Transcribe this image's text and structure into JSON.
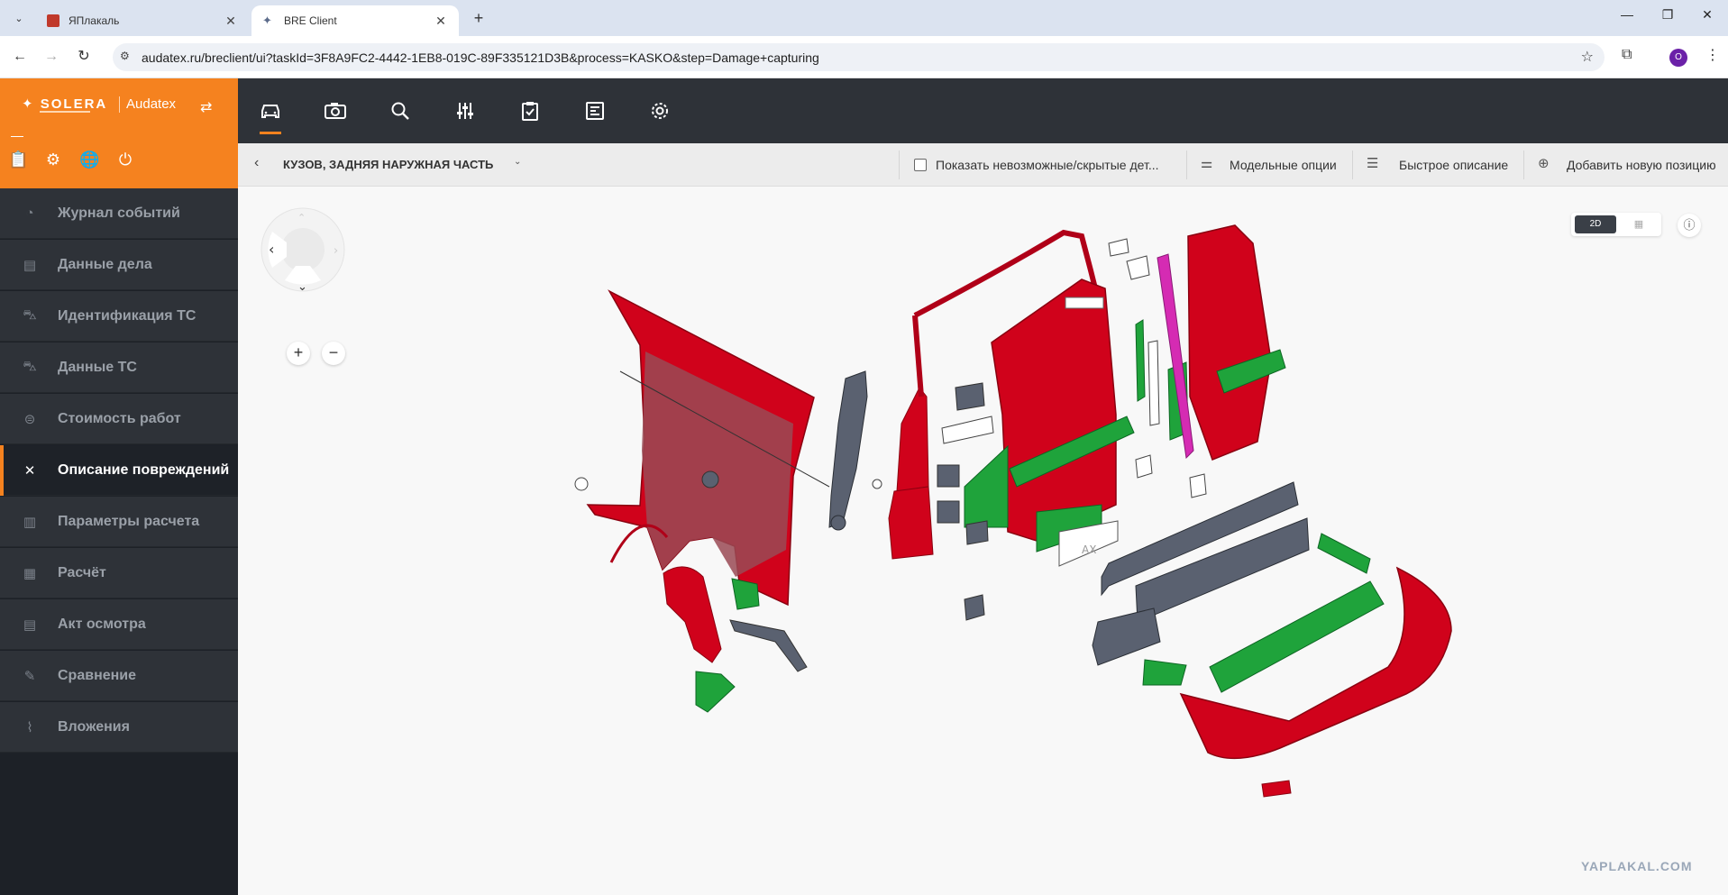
{
  "browser": {
    "tabs": [
      {
        "title": "ЯПлакаль",
        "active": false
      },
      {
        "title": "BRE Client",
        "active": true
      }
    ],
    "url": "audatex.ru/breclient/ui?taskId=3F8A9FC2-4442-1EB8-019C-89F335121D3B&process=KASKO&step=Damage+capturing",
    "profile_initial": "O"
  },
  "brand": {
    "logo": "SOLERA",
    "product": "Audatex"
  },
  "sidebar": {
    "items": [
      {
        "label": "Журнал событий",
        "icon": "history-icon",
        "active": false
      },
      {
        "label": "Данные дела",
        "icon": "document-icon",
        "active": false
      },
      {
        "label": "Идентификация ТС",
        "icon": "car-icon",
        "active": false
      },
      {
        "label": "Данные ТС",
        "icon": "car-data-icon",
        "active": false
      },
      {
        "label": "Стоимость работ",
        "icon": "labor-cost-icon",
        "active": false
      },
      {
        "label": "Описание повреждений",
        "icon": "tools-icon",
        "active": true
      },
      {
        "label": "Параметры расчета",
        "icon": "calc-params-icon",
        "active": false
      },
      {
        "label": "Расчёт",
        "icon": "calculation-icon",
        "active": false
      },
      {
        "label": "Акт осмотра",
        "icon": "inspection-icon",
        "active": false
      },
      {
        "label": "Сравнение",
        "icon": "compare-icon",
        "active": false
      },
      {
        "label": "Вложения",
        "icon": "paperclip-icon",
        "active": false
      }
    ]
  },
  "subheader": {
    "section_title": "КУЗОВ, ЗАДНЯЯ НАРУЖНАЯ ЧАСТЬ",
    "show_hidden_label": "Показать невозможные/скрытые дет...",
    "show_hidden_checked": false,
    "model_options_label": "Модельные опции",
    "quick_desc_label": "Быстрое описание",
    "add_position_label": "Добавить новую позицию"
  },
  "view": {
    "mode_2d": "2D",
    "active_mode": "2D"
  },
  "watermark": "YAPLAKAL.COM",
  "colors": {
    "accent": "#f5821f",
    "damaged": "#d0021b",
    "replaced": "#1fa33b",
    "neutral": "#5a6170",
    "highlight": "#d52bb3"
  }
}
